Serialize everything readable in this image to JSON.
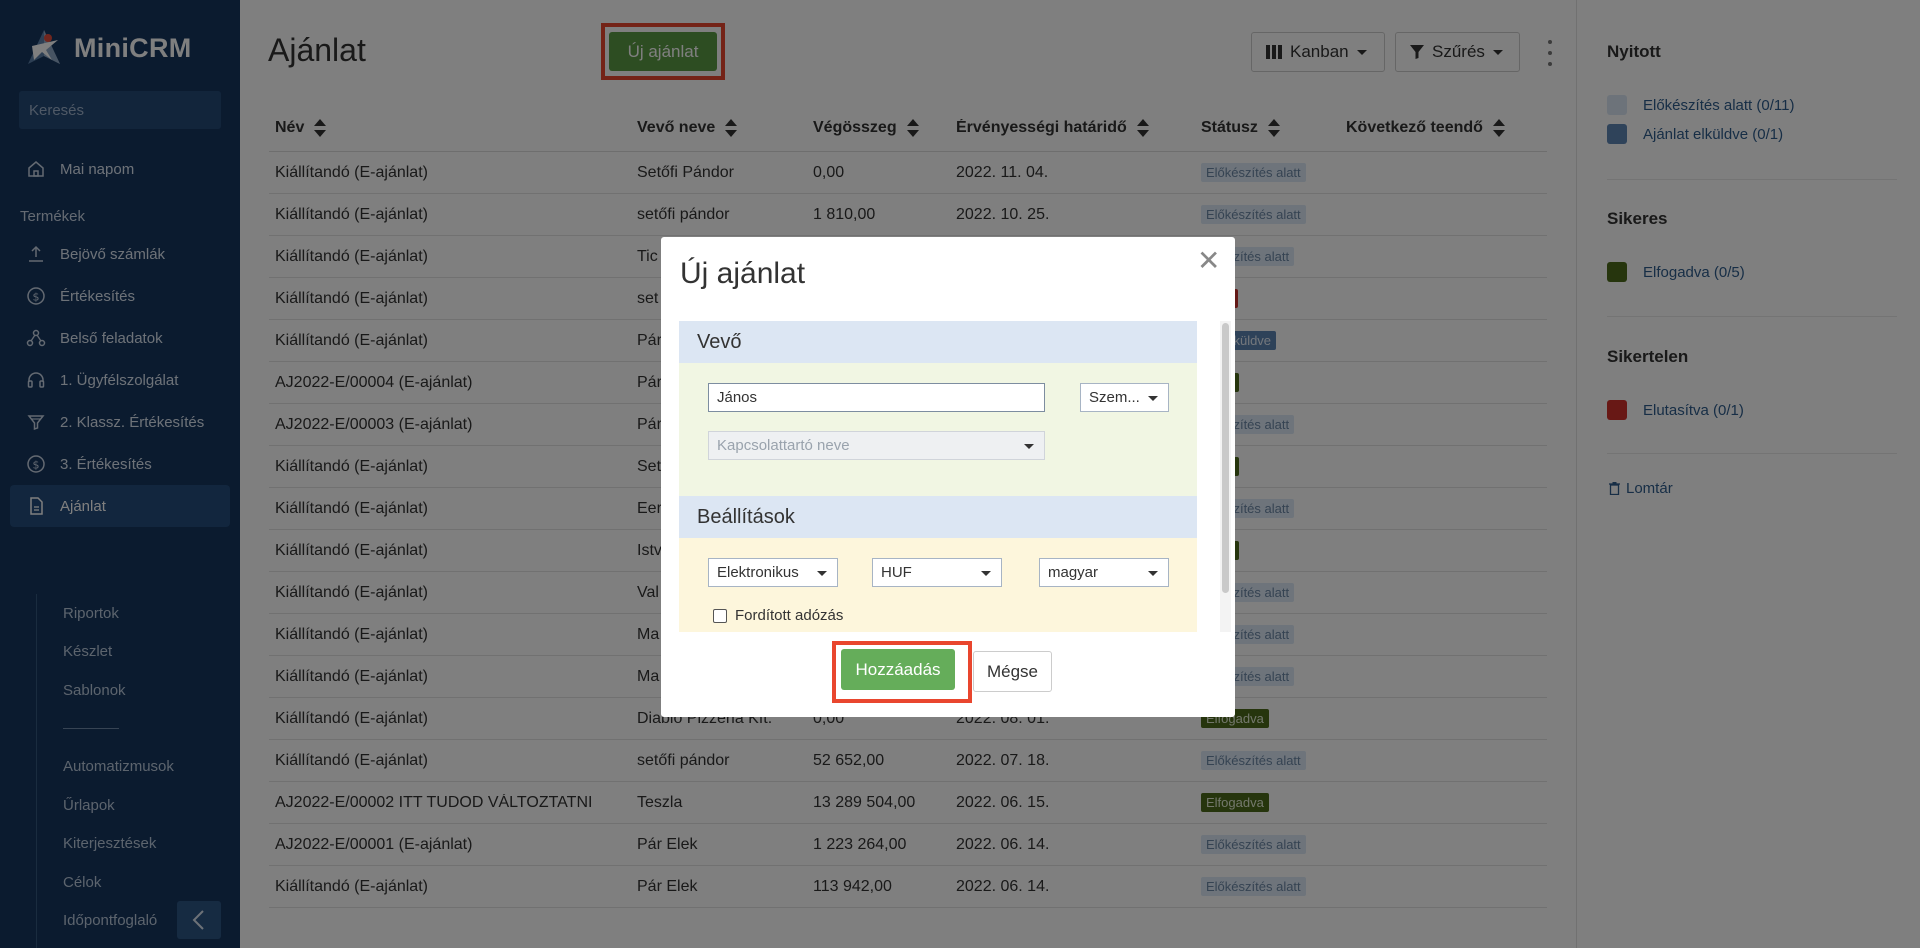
{
  "app": {
    "name": "MiniCRM"
  },
  "sidebar": {
    "search_placeholder": "Keresés",
    "home": "Mai napom",
    "section": "Termékek",
    "items": [
      "Bejövő számlák",
      "Értékesítés",
      "Belső feladatok",
      "1. Ügyfélszolgálat",
      "2. Klassz. Értékesítés",
      "3. Értékesítés",
      "Ajánlat"
    ],
    "subitems": [
      "Riportok",
      "Készlet",
      "Sablonok",
      "Automatizmusok",
      "Űrlapok",
      "Kiterjesztések",
      "Célok",
      "Időpontfoglaló"
    ]
  },
  "main": {
    "title": "Ajánlat",
    "new_button": "Új ajánlat",
    "kanban_button": "Kanban",
    "filter_button": "Szűrés",
    "columns": [
      "Név",
      "Vevő neve",
      "Végösszeg",
      "Érvényességi határidő",
      "Státusz",
      "Következő teendő"
    ],
    "rows": [
      {
        "name": "Kiállítandó (E-ajánlat)",
        "customer": "Setőfi Pándor",
        "total": "0,00",
        "deadline": "2022. 11. 04.",
        "status": "Előkészítés alatt"
      },
      {
        "name": "Kiállítandó (E-ajánlat)",
        "customer": "setőfi pándor",
        "total": "1 810,00",
        "deadline": "2022. 10. 25.",
        "status": "Előkészítés alatt"
      },
      {
        "name": "Kiállítandó (E-ajánlat)",
        "customer": "Tic",
        "total": "",
        "deadline": "",
        "status": "őkészítés alatt"
      },
      {
        "name": "Kiállítandó (E-ajánlat)",
        "customer": "set",
        "total": "",
        "deadline": "",
        "status": "sítva"
      },
      {
        "name": "Kiállítandó (E-ajánlat)",
        "customer": "Pár",
        "total": "",
        "deadline": "",
        "status": "lat elküldve"
      },
      {
        "name": "AJ2022-E/00004 (E-ajánlat)",
        "customer": "Pár",
        "total": "",
        "deadline": "",
        "status": "adva"
      },
      {
        "name": "AJ2022-E/00003 (E-ajánlat)",
        "customer": "Pár",
        "total": "",
        "deadline": "",
        "status": "őkészítés alatt"
      },
      {
        "name": "Kiállítandó (E-ajánlat)",
        "customer": "Set",
        "total": "",
        "deadline": "",
        "status": "adva"
      },
      {
        "name": "Kiállítandó (E-ajánlat)",
        "customer": "Eer",
        "total": "",
        "deadline": "",
        "status": "őkészítés alatt"
      },
      {
        "name": "Kiállítandó (E-ajánlat)",
        "customer": "Istv",
        "total": "",
        "deadline": "",
        "status": "adva"
      },
      {
        "name": "Kiállítandó (E-ajánlat)",
        "customer": "Val",
        "total": "",
        "deadline": "",
        "status": "őkészítés alatt"
      },
      {
        "name": "Kiállítandó (E-ajánlat)",
        "customer": "Ma",
        "total": "",
        "deadline": "",
        "status": "őkészítés alatt"
      },
      {
        "name": "Kiállítandó (E-ajánlat)",
        "customer": "Ma",
        "total": "",
        "deadline": "",
        "status": "őkészítés alatt"
      },
      {
        "name": "Kiállítandó (E-ajánlat)",
        "customer": "Diablo Pizzéria Kft.",
        "total": "0,00",
        "deadline": "2022. 08. 01.",
        "status": "Elfogadva"
      },
      {
        "name": "Kiállítandó (E-ajánlat)",
        "customer": "setőfi pándor",
        "total": "52 652,00",
        "deadline": "2022. 07. 18.",
        "status": "Előkészítés alatt"
      },
      {
        "name": "AJ2022-E/00002 ITT TUDOD VÁLTOZTATNI",
        "customer": "Teszla",
        "total": "13 289 504,00",
        "deadline": "2022. 06. 15.",
        "status": "Elfogadva"
      },
      {
        "name": "AJ2022-E/00001 (E-ajánlat)",
        "customer": "Pár Elek",
        "total": "1 223 264,00",
        "deadline": "2022. 06. 14.",
        "status": "Előkészítés alatt"
      },
      {
        "name": "Kiállítandó (E-ajánlat)",
        "customer": "Pár Elek",
        "total": "113 942,00",
        "deadline": "2022. 06. 14.",
        "status": "Előkészítés alatt"
      }
    ]
  },
  "right_panel": {
    "open_title": "Nyitott",
    "open_items": [
      "Előkészítés alatt (0/11)",
      "Ajánlat elküldve (0/1)"
    ],
    "success_title": "Sikeres",
    "success_items": [
      "Elfogadva (0/5)"
    ],
    "fail_title": "Sikertelen",
    "fail_items": [
      "Elutasítva (0/1)"
    ],
    "trash": "Lomtár",
    "colors": {
      "prep": "#dbe7f4",
      "sent": "#5e86b5",
      "accepted": "#4d6b1b",
      "rejected": "#d0302a"
    }
  },
  "modal": {
    "title": "Új ajánlat",
    "buyer_section": "Vevő",
    "buyer_name_value": "János",
    "buyer_type": "Szem...",
    "contact_placeholder": "Kapcsolattartó neve",
    "settings_section": "Beállítások",
    "type_value": "Elektronikus",
    "currency_value": "HUF",
    "language_value": "magyar",
    "reverse_tax_label": "Fordított adózás",
    "add_button": "Hozzáadás",
    "cancel_button": "Mégse"
  }
}
